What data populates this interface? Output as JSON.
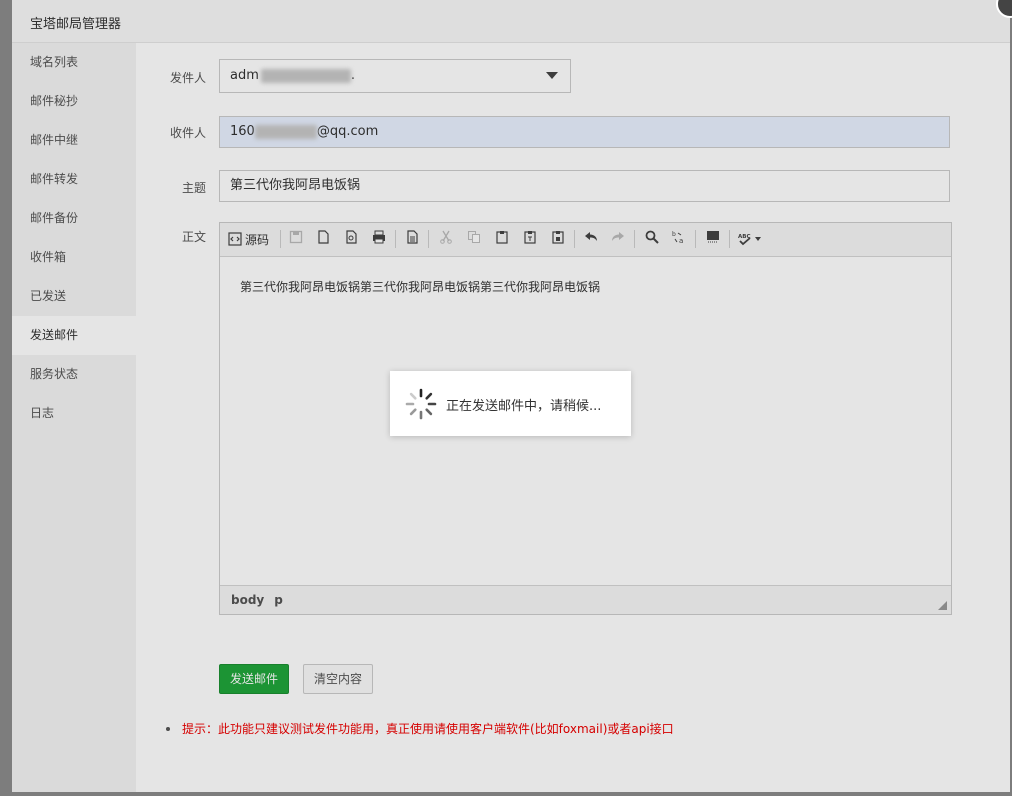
{
  "window": {
    "title": "宝塔邮局管理器"
  },
  "sidebar": {
    "items": [
      {
        "label": "域名列表"
      },
      {
        "label": "邮件秘抄"
      },
      {
        "label": "邮件中继"
      },
      {
        "label": "邮件转发"
      },
      {
        "label": "邮件备份"
      },
      {
        "label": "收件箱"
      },
      {
        "label": "已发送"
      },
      {
        "label": "发送邮件",
        "active": true
      },
      {
        "label": "服务状态"
      },
      {
        "label": "日志"
      }
    ]
  },
  "form": {
    "from_label": "发件人",
    "from_value": "adm",
    "from_suffix": ".",
    "to_label": "收件人",
    "to_value_prefix": "160",
    "to_value_suffix": "@qq.com",
    "subject_label": "主题",
    "subject_value": "第三代你我阿昂电饭锅",
    "body_label": "正文"
  },
  "editor": {
    "source_label": "源码",
    "content": "第三代你我阿昂电饭锅第三代你我阿昂电饭锅第三代你我阿昂电饭锅",
    "path": [
      "body",
      "p"
    ]
  },
  "buttons": {
    "send": "发送邮件",
    "clear": "清空内容"
  },
  "tip": "提示：此功能只建议测试发件功能用，真正使用请使用客户端软件(比如foxmail)或者api接口",
  "loading": {
    "text": "正在发送邮件中，请稍候..."
  },
  "colors": {
    "primary": "#20a53a",
    "tip": "#e00000"
  }
}
